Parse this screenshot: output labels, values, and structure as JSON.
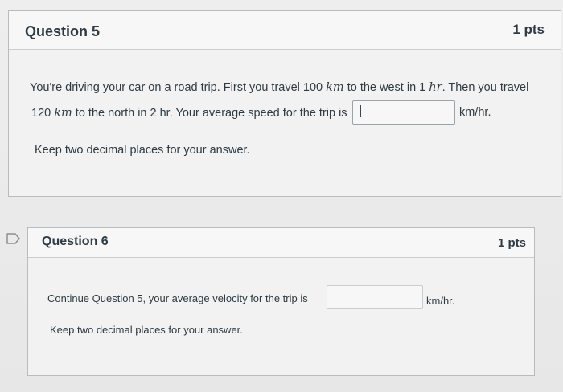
{
  "question5": {
    "title": "Question 5",
    "points": "1 pts",
    "line1_a": "You're driving your car on a road trip. First you travel 100 ",
    "line1_km": "km",
    "line1_b": " to the west in 1 ",
    "line1_hr": "hr",
    "line1_c": ". Then you travel",
    "line2_a": "120 ",
    "line2_km": "km",
    "line2_b": " to the north in 2 hr. Your average speed for the trip is",
    "unit": "km/hr.",
    "answer_value": "",
    "instruction": "Keep two decimal places for your answer."
  },
  "question6": {
    "title": "Question 6",
    "points": "1 pts",
    "prompt": "Continue Question 5, your average velocity for the trip is",
    "unit": "km/hr.",
    "answer_value": "",
    "instruction": "Keep two decimal places for your answer."
  },
  "icons": {
    "flag": "bookmark-flag-icon"
  }
}
